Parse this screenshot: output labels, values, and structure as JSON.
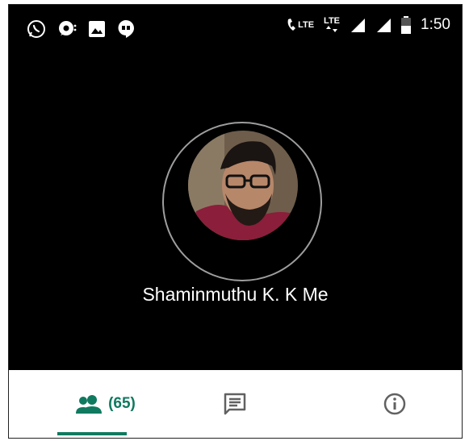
{
  "status_bar": {
    "time": "1:50",
    "lte_1": "LTE",
    "lte_2": "LTE",
    "icons_left": [
      "whatsapp-icon",
      "chat-bubble-icon",
      "image-icon",
      "hangouts-icon"
    ],
    "icons_right": [
      "wifi-call-icon",
      "lte-icon",
      "lte-data-icon",
      "signal-icon",
      "signal-icon",
      "battery-icon"
    ]
  },
  "profile": {
    "name": "Shaminmuthu K. K Me"
  },
  "tabs": [
    {
      "icon": "people-icon",
      "count": "(65)",
      "selected": true
    },
    {
      "icon": "message-icon",
      "selected": false
    },
    {
      "icon": "info-icon",
      "selected": false
    }
  ],
  "colors": {
    "accent": "#0f7a5f",
    "background": "#000000",
    "tab_background": "#ffffff",
    "ring": "#9e9e9e"
  }
}
